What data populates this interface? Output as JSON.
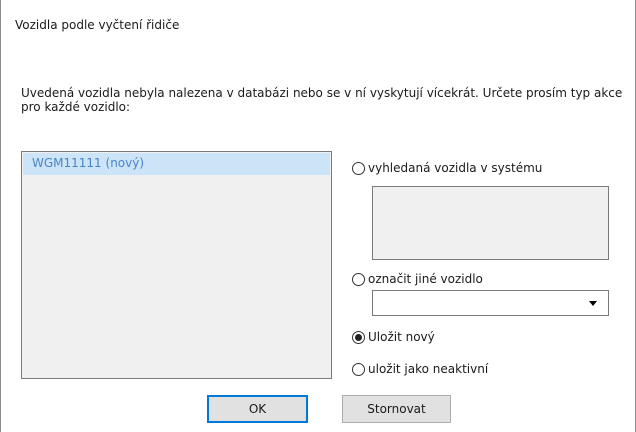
{
  "dialog": {
    "title": "Vozidla podle vyčtení řidiče",
    "message": "Uvedená vozidla nebyla nalezena v databázi nebo se v ní vyskytují vícekrát. Určete prosím typ akce pro každé vozidlo:"
  },
  "vehicle_list": {
    "items": [
      {
        "label": "WGM11111 (nový)",
        "selected": true
      }
    ]
  },
  "options": {
    "found_vehicles": {
      "label": "vyhledaná vozidla v systému",
      "checked": false
    },
    "mark_other": {
      "label": "označit jiné vozidlo",
      "checked": false
    },
    "save_new": {
      "label": "Uložit nový",
      "checked": true
    },
    "save_inactive": {
      "label": "uložit jako neaktivní",
      "checked": false
    }
  },
  "other_vehicle_select": {
    "value": ""
  },
  "buttons": {
    "ok": "OK",
    "cancel": "Stornovat"
  },
  "colors": {
    "selection_background": "#cce4f7",
    "selection_text": "#4a84c6",
    "focus_border": "#0078d7",
    "panel_background": "#f0f0f0"
  }
}
